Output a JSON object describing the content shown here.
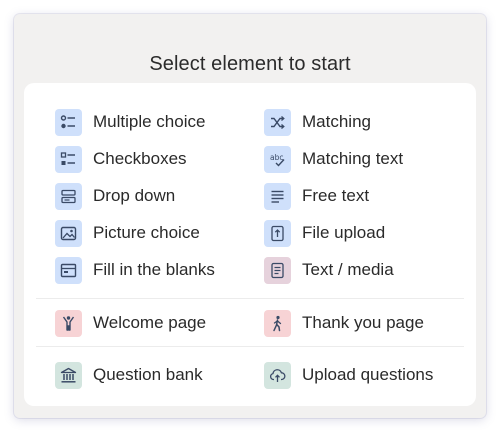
{
  "dialog": {
    "title": "Select element to start"
  },
  "colors": {
    "blue_bg": "#cfe0fb",
    "blue_fg": "#3a4a66",
    "mauve_bg": "#e6d2dc",
    "pink_bg": "#f7d3d5",
    "green_bg": "#d3e5df",
    "panel_bg": "#ffffff",
    "outer_bg": "#f2f1f0"
  },
  "elements": {
    "left": [
      {
        "label": "Multiple choice",
        "icon": "multiple-choice-icon"
      },
      {
        "label": "Checkboxes",
        "icon": "checkboxes-icon"
      },
      {
        "label": "Drop down",
        "icon": "dropdown-icon"
      },
      {
        "label": "Picture choice",
        "icon": "picture-icon"
      },
      {
        "label": "Fill in the blanks",
        "icon": "fill-blanks-icon"
      }
    ],
    "right": [
      {
        "label": "Matching",
        "icon": "shuffle-icon"
      },
      {
        "label": "Matching text",
        "icon": "spellcheck-icon"
      },
      {
        "label": "Free text",
        "icon": "text-lines-icon"
      },
      {
        "label": "File upload",
        "icon": "file-upload-icon"
      },
      {
        "label": "Text / media",
        "icon": "document-icon"
      }
    ]
  },
  "pages": {
    "welcome": {
      "label": "Welcome page",
      "icon": "person-celebrating-icon"
    },
    "thank_you": {
      "label": "Thank you page",
      "icon": "person-walking-icon"
    }
  },
  "tools": {
    "question_bank": {
      "label": "Question bank",
      "icon": "bank-icon"
    },
    "upload_questions": {
      "label": "Upload questions",
      "icon": "cloud-upload-icon"
    }
  }
}
